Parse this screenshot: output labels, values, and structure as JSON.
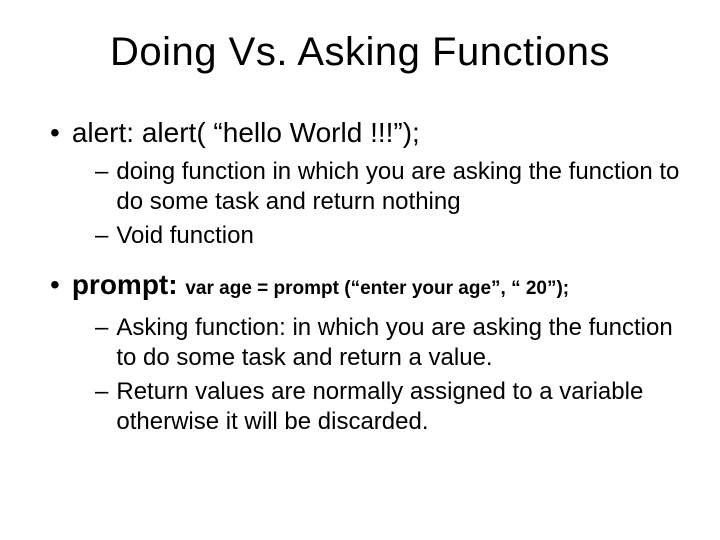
{
  "title": "Doing Vs. Asking Functions",
  "bullets": [
    {
      "label": "alert:  ",
      "code": "alert( “hello World !!!”);",
      "subs": [
        "doing function in which you are asking the function to do some task and return nothing",
        "Void function"
      ]
    },
    {
      "label": "prompt: ",
      "code": "var age = prompt (“enter your age”, “ 20”);",
      "subs": [
        "Asking function: in which you are asking the function to do some task and return a value.",
        "Return values are normally assigned to a variable otherwise it will be discarded."
      ]
    }
  ]
}
